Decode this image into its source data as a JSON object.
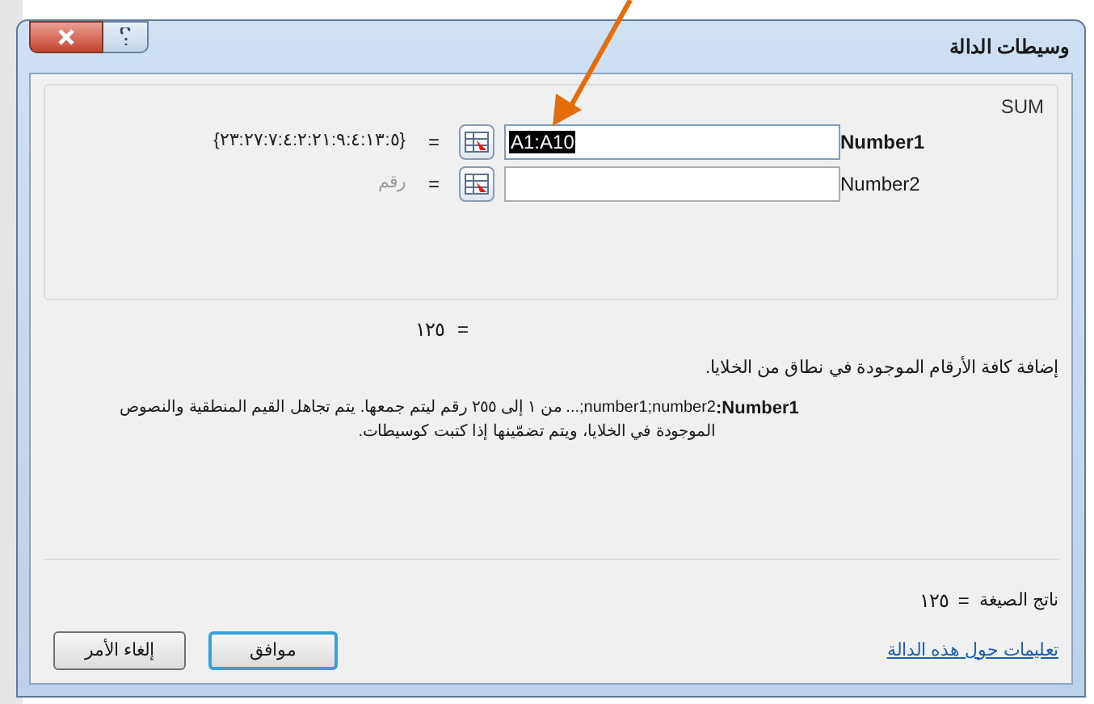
{
  "window": {
    "title": "وسيطات الدالة"
  },
  "function": {
    "name": "SUM",
    "arguments": [
      {
        "label": "Number1",
        "bold": true,
        "value": "A1:A10",
        "highlighted": true,
        "equals": "=",
        "result": "{٢٣:٢٧:٧:٤:٢:٢١:٩:٤:١٣:٥}",
        "kind": "value"
      },
      {
        "label": "Number2",
        "bold": false,
        "highlighted": false,
        "equals": "=",
        "result": "رقم",
        "kind": "hint"
      }
    ]
  },
  "function_result": {
    "equals": "=",
    "value": "١٢٥"
  },
  "description": "إضافة كافة الأرقام الموجودة في نطاق من الخلايا.",
  "argument_help": {
    "label": "Number1:",
    "text": "number1;number2;... من ١ إلى ٢٥٥ رقم ليتم جمعها. يتم تجاهل القيم المنطقية والنصوص الموجودة في الخلايا، ويتم تضمّينها إذا كتبت كوسيطات."
  },
  "formula_result": {
    "label": "ناتج الصيغة",
    "equals": "=",
    "value": "١٢٥"
  },
  "help_link": "تعليمات حول هذه الدالة",
  "buttons": [
    {
      "label": "موافق",
      "default": true
    },
    {
      "label": "إلغاء الأمر",
      "default": false
    }
  ]
}
